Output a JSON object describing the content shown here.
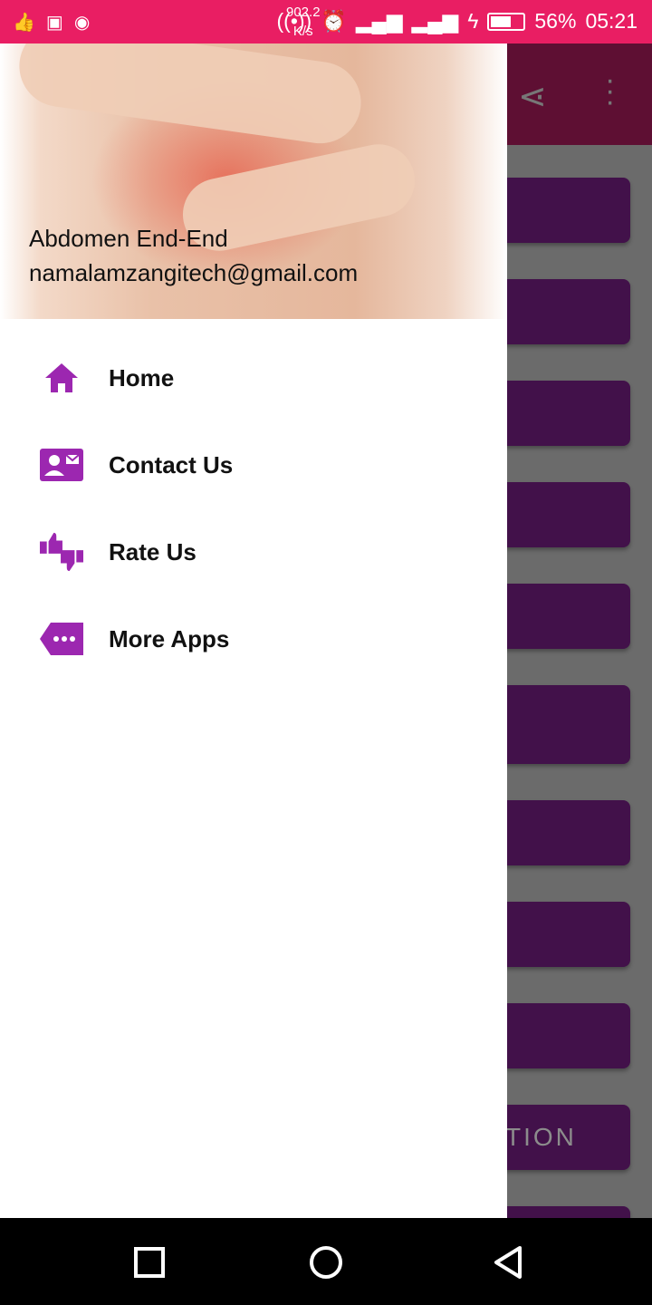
{
  "status_bar": {
    "speed_value": "902.2",
    "speed_unit": "K/s",
    "battery": "56%",
    "battery_level": 0.56,
    "time": "05:21",
    "color": "#e91e63"
  },
  "background": {
    "card_fragment": "TION",
    "card_color": "#42114a"
  },
  "drawer": {
    "header": {
      "app_name": "Abdomen End-End",
      "email": "namalamzangitech@gmail.com"
    },
    "accent": "#9c27b0",
    "items": [
      {
        "label": "Home",
        "icon": "home-icon"
      },
      {
        "label": "Contact Us",
        "icon": "contact-card-icon"
      },
      {
        "label": "Rate Us",
        "icon": "thumbs-up-down-icon"
      },
      {
        "label": "More Apps",
        "icon": "more-tag-icon"
      }
    ]
  }
}
